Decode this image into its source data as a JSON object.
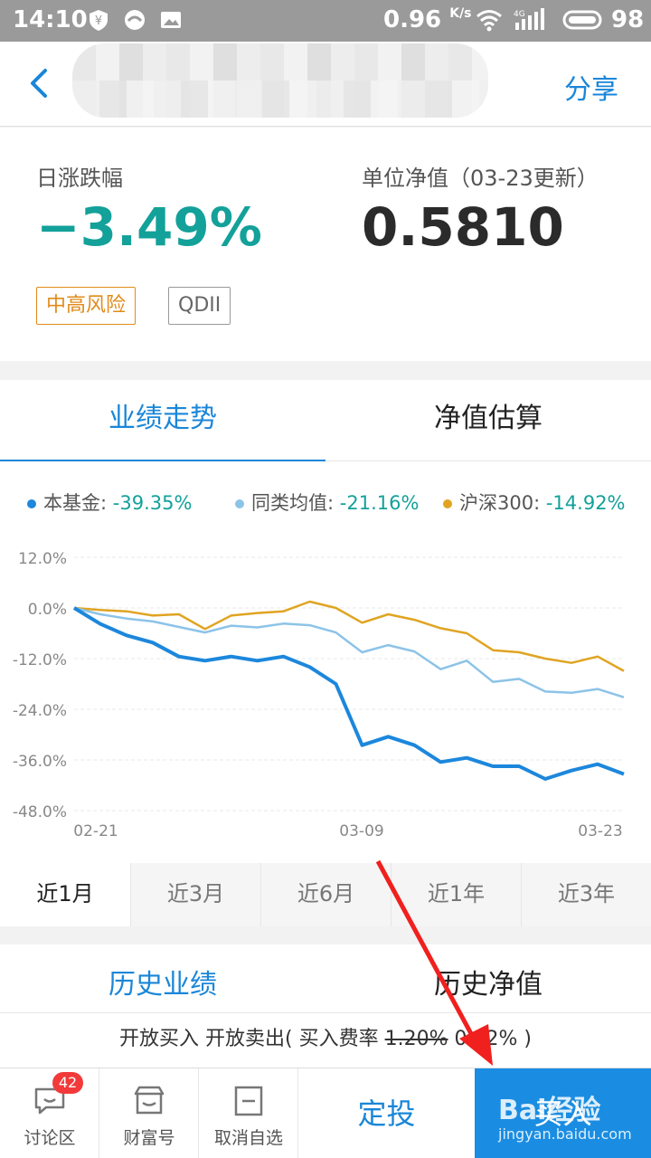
{
  "status_bar": {
    "time": "14:10",
    "speed": "0.96",
    "speed_unit": "K/s",
    "network": "4G",
    "battery": "98"
  },
  "nav": {
    "share_label": "分享"
  },
  "summary": {
    "change_label": "日涨跌幅",
    "change_value": "−3.49%",
    "nav_label": "单位净值（03-23更新）",
    "nav_value": "0.5810",
    "risk_tag": "中高风险",
    "type_tag": "QDII"
  },
  "tabs": [
    {
      "label": "业绩走势",
      "active": true
    },
    {
      "label": "净值估算",
      "active": false
    }
  ],
  "colors": {
    "accent": "#1a86d8",
    "down": "#13a19a",
    "fund_line": "#1c87dc",
    "peer_line": "#8cc3e8",
    "index_line": "#e0a422",
    "risk": "#e08b1b"
  },
  "chart_data": {
    "type": "line",
    "legend": [
      {
        "name": "本基金",
        "value": "-39.35%"
      },
      {
        "name": "同类均值",
        "value": "-21.16%"
      },
      {
        "name": "沪深300",
        "value": "-14.92%"
      }
    ],
    "x_ticks": [
      "02-21",
      "03-09",
      "03-23"
    ],
    "y_ticks": [
      "12.0%",
      "0.0%",
      "-12.0%",
      "-24.0%",
      "-36.0%",
      "-48.0%"
    ],
    "ylim": [
      -48,
      12
    ],
    "grid": true,
    "legend_position": "top",
    "series": [
      {
        "name": "本基金",
        "values": [
          0,
          -3.8,
          -6.5,
          -8.2,
          -11.5,
          -12.5,
          -11.5,
          -12.5,
          -11.5,
          -14,
          -18,
          -32.5,
          -30.5,
          -32.5,
          -36.5,
          -35.5,
          -37.5,
          -37.5,
          -40.5,
          -38.5,
          -37,
          -39.35
        ]
      },
      {
        "name": "同类均值",
        "values": [
          0,
          -1.5,
          -2.5,
          -3.2,
          -4.5,
          -5.8,
          -4.2,
          -4.6,
          -3.7,
          -4.1,
          -5.8,
          -10.5,
          -8.8,
          -10.3,
          -14.5,
          -12.5,
          -17.5,
          -16.8,
          -19.8,
          -20.1,
          -19.2,
          -21.16
        ]
      },
      {
        "name": "沪深300",
        "values": [
          0,
          -0.5,
          -0.8,
          -1.8,
          -1.5,
          -5,
          -1.8,
          -1.2,
          -0.8,
          1.5,
          0,
          -3.5,
          -1.5,
          -2.8,
          -4.8,
          -6,
          -10,
          -10.5,
          -12,
          -13,
          -11.5,
          -14.92
        ]
      }
    ]
  },
  "periods": [
    {
      "label": "近1月",
      "active": true
    },
    {
      "label": "近3月",
      "active": false
    },
    {
      "label": "近6月",
      "active": false
    },
    {
      "label": "近1年",
      "active": false
    },
    {
      "label": "近3年",
      "active": false
    }
  ],
  "history_tabs": [
    {
      "label": "历史业绩",
      "active": true
    },
    {
      "label": "历史净值",
      "active": false
    }
  ],
  "notice": {
    "prefix": "开放买入 开放卖出( 买入费率 ",
    "old_rate": "1.20%",
    "new_rate": " 0.12% )"
  },
  "bottom_bar": {
    "discuss_label": "讨论区",
    "discuss_badge": "42",
    "fortune_label": "财富号",
    "unwatch_label": "取消自选",
    "dingtou_label": "定投",
    "buy_label": "买入"
  },
  "watermark": {
    "brand": "Bai经验",
    "site": "jingyan.baidu.com"
  }
}
